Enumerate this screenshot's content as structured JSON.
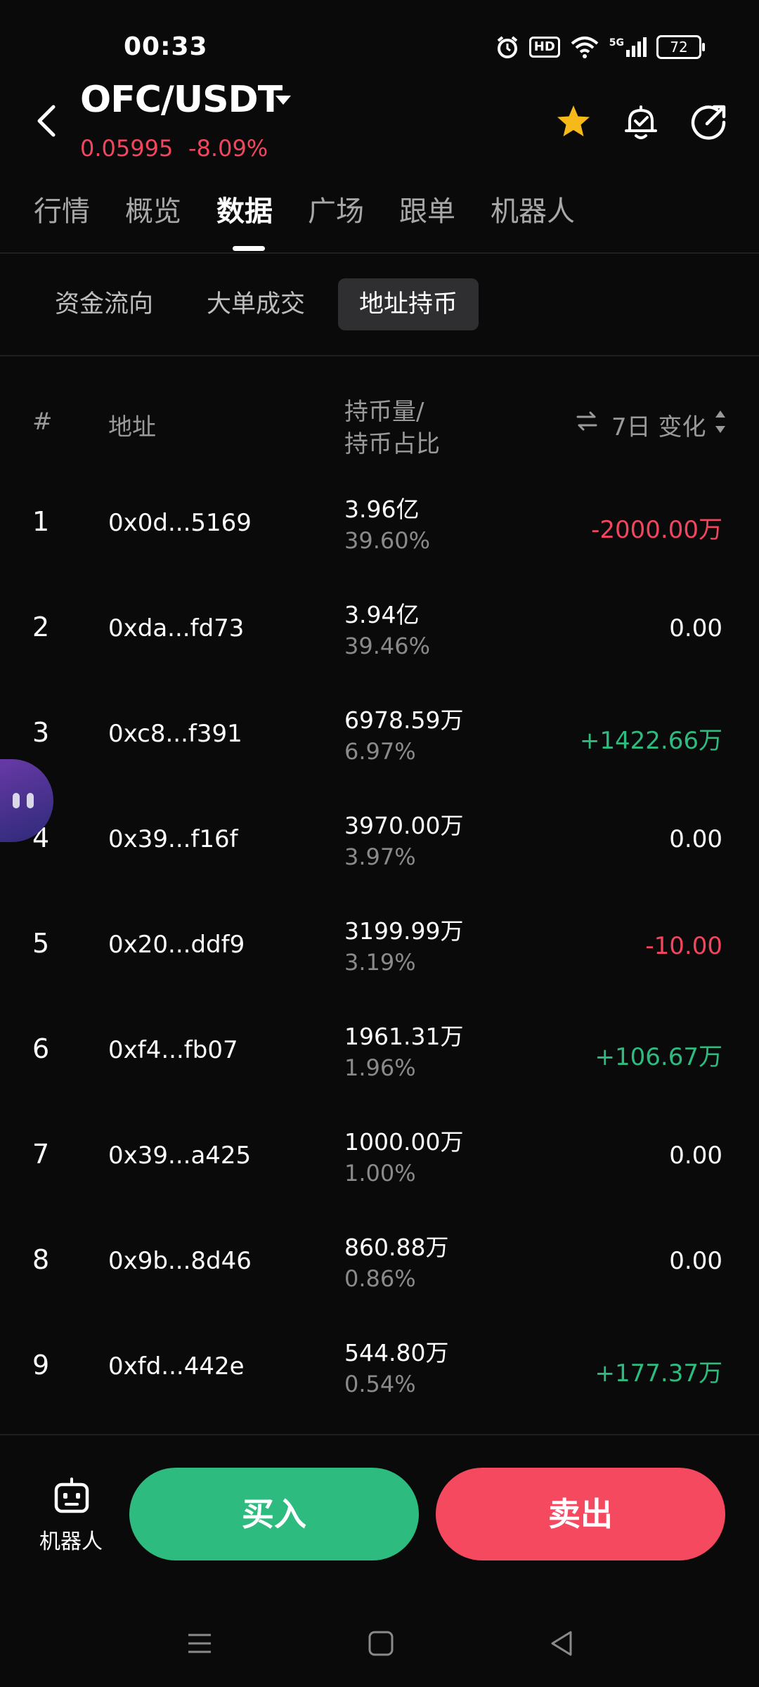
{
  "status": {
    "time": "00:33",
    "hd": "HD",
    "network": "5G",
    "battery": "72"
  },
  "header": {
    "pair": "OFC/USDT",
    "price": "0.05995",
    "change": "-8.09%"
  },
  "main_tabs": [
    {
      "label": "行情"
    },
    {
      "label": "概览"
    },
    {
      "label": "数据"
    },
    {
      "label": "广场"
    },
    {
      "label": "跟单"
    },
    {
      "label": "机器人"
    }
  ],
  "sub_tabs": [
    {
      "label": "资金流向"
    },
    {
      "label": "大单成交"
    },
    {
      "label": "地址持币"
    }
  ],
  "table": {
    "col_rank": "#",
    "col_address": "地址",
    "col_holding_line1": "持币量/",
    "col_holding_line2": "持币占比",
    "col_change": "7日 变化",
    "rows": [
      {
        "rank": "1",
        "address": "0x0d...5169",
        "amount": "3.96亿",
        "percent": "39.60%",
        "change": "-2000.00万",
        "trend": "neg"
      },
      {
        "rank": "2",
        "address": "0xda...fd73",
        "amount": "3.94亿",
        "percent": "39.46%",
        "change": "0.00",
        "trend": "neu"
      },
      {
        "rank": "3",
        "address": "0xc8...f391",
        "amount": "6978.59万",
        "percent": "6.97%",
        "change": "+1422.66万",
        "trend": "pos"
      },
      {
        "rank": "4",
        "address": "0x39...f16f",
        "amount": "3970.00万",
        "percent": "3.97%",
        "change": "0.00",
        "trend": "neu"
      },
      {
        "rank": "5",
        "address": "0x20...ddf9",
        "amount": "3199.99万",
        "percent": "3.19%",
        "change": "-10.00",
        "trend": "neg"
      },
      {
        "rank": "6",
        "address": "0xf4...fb07",
        "amount": "1961.31万",
        "percent": "1.96%",
        "change": "+106.67万",
        "trend": "pos"
      },
      {
        "rank": "7",
        "address": "0x39...a425",
        "amount": "1000.00万",
        "percent": "1.00%",
        "change": "0.00",
        "trend": "neu"
      },
      {
        "rank": "8",
        "address": "0x9b...8d46",
        "amount": "860.88万",
        "percent": "0.86%",
        "change": "0.00",
        "trend": "neu"
      },
      {
        "rank": "9",
        "address": "0xfd...442e",
        "amount": "544.80万",
        "percent": "0.54%",
        "change": "+177.37万",
        "trend": "pos"
      }
    ]
  },
  "bottom": {
    "robot_label": "机器人",
    "buy_label": "买入",
    "sell_label": "卖出"
  },
  "icons": {
    "back": "back-arrow-icon",
    "star": "star-icon",
    "alarm": "bell-alarm-icon",
    "share": "share-icon",
    "swap": "swap-arrows-icon",
    "sort": "sort-icon",
    "robot": "robot-icon"
  },
  "colors": {
    "positive": "#2dbb7f",
    "negative": "#f0465e",
    "favorite": "#f5b91a",
    "background": "#0a0a0a"
  }
}
